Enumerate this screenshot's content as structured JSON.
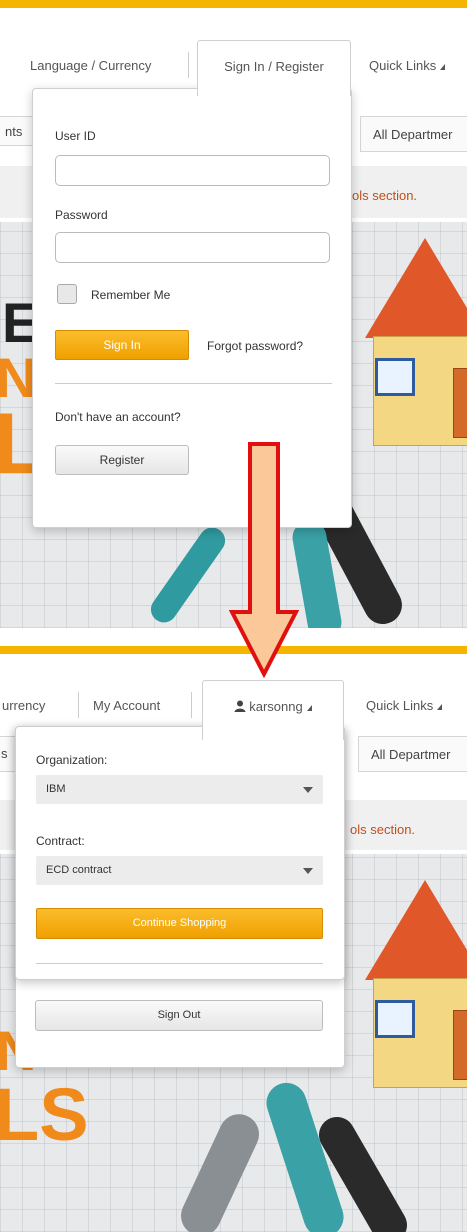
{
  "top": {
    "nav": {
      "language_currency": "Language / Currency",
      "signin_tab": "Sign In / Register",
      "quick_links": "Quick Links"
    },
    "background": {
      "left_fragment": "nts",
      "all_departments": "All Departmer",
      "section_msg": "ols section."
    },
    "signin": {
      "user_id_label": "User ID",
      "user_id_value": "",
      "password_label": "Password",
      "password_value": "",
      "remember_me": "Remember Me",
      "sign_in_button": "Sign In",
      "forgot_password": "Forgot password?",
      "no_account": "Don't have an account?",
      "register_button": "Register"
    },
    "big_letters": [
      "E",
      "N",
      "L"
    ]
  },
  "bottom": {
    "nav": {
      "currency_fragment": "urrency",
      "my_account": "My Account",
      "user_tab": "karsonng",
      "quick_links": "Quick Links"
    },
    "background": {
      "left_fragment": "s",
      "all_departments": "All Departmer",
      "section_msg": "ols section."
    },
    "account": {
      "organization_label": "Organization:",
      "organization_value": "IBM",
      "contract_label": "Contract:",
      "contract_value": "ECD contract",
      "continue_button": "Continue Shopping",
      "sign_out_button": "Sign Out"
    },
    "big_letters": [
      "N",
      "LS"
    ]
  },
  "colors": {
    "brand_orange": "#f5b400",
    "button_orange": "#f0a000",
    "arrow_fill": "#fbc89a",
    "arrow_stroke": "#e01010",
    "message_text": "#c0501a"
  },
  "icons": {
    "user": "user-icon",
    "caret": "caret-down-icon",
    "select_arrow": "chevron-down-icon",
    "transition_arrow": "down-arrow-icon"
  }
}
